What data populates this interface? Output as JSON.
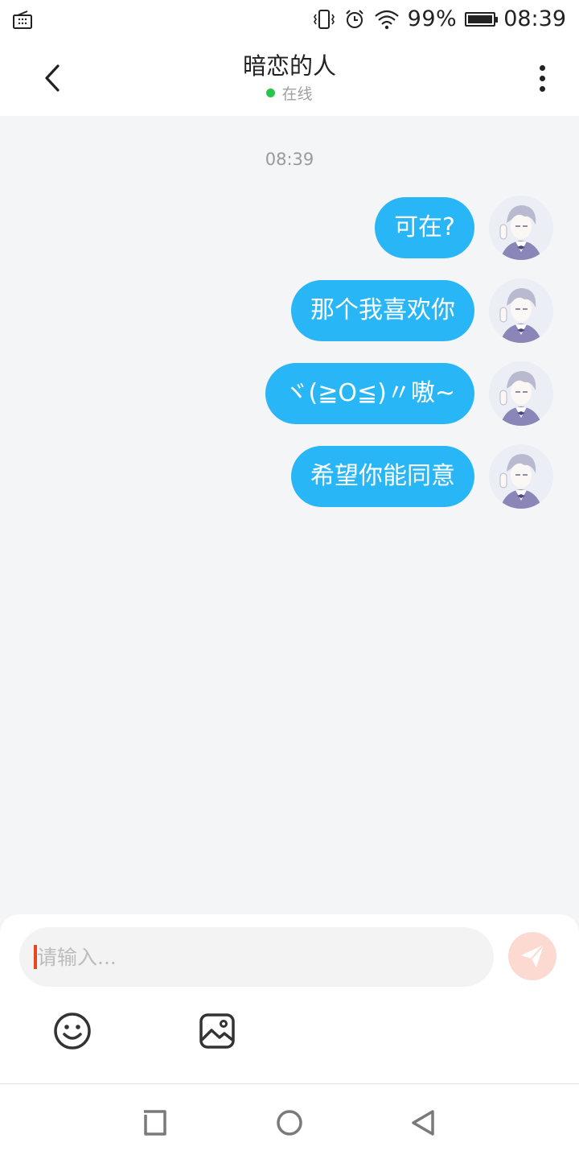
{
  "status_bar": {
    "battery": "99%",
    "battery_level": 0.99,
    "time": "08:39",
    "icons": [
      "radio-icon",
      "vibrate-icon",
      "alarm-icon",
      "wifi-icon",
      "battery-icon"
    ]
  },
  "header": {
    "title": "暗恋的人",
    "presence": "在线",
    "presence_color": "#27c64a"
  },
  "chat": {
    "timestamp": "08:39",
    "bubble_color": "#29b6f6",
    "messages": [
      {
        "text": "可在?"
      },
      {
        "text": "那个我喜欢你"
      },
      {
        "text": "ヾ(≧O≦)〃嗷~"
      },
      {
        "text": "希望你能同意"
      }
    ]
  },
  "composer": {
    "placeholder": "请输入...",
    "value": "",
    "send_icon": "send-icon",
    "tools": [
      "emoji-icon",
      "image-icon"
    ]
  },
  "navigation": {
    "buttons": [
      "recent-apps-icon",
      "home-icon",
      "back-icon"
    ]
  }
}
